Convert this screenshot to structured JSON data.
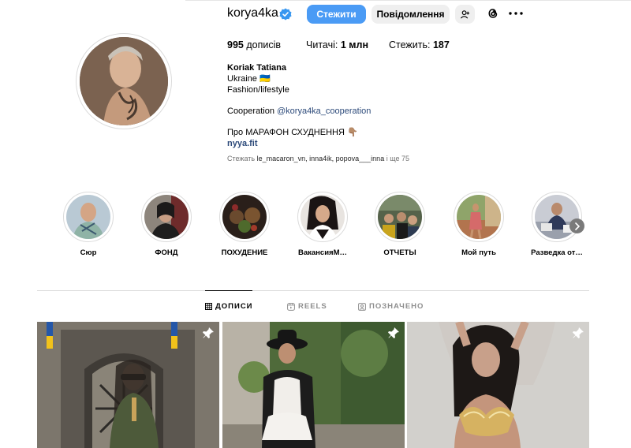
{
  "profile": {
    "username": "korya4ka",
    "verified": true,
    "follow_label": "Стежити",
    "message_label": "Повідомлення",
    "add_user_icon": "add-user-icon",
    "threads_icon": "threads-icon",
    "more_icon": "more-icon"
  },
  "stats": {
    "posts_count": "995",
    "posts_label": "дописів",
    "followers_label": "Читачі:",
    "followers_count": "1 млн",
    "following_label": "Стежить:",
    "following_count": "187"
  },
  "bio": {
    "full_name": "Koriak Tatiana",
    "line_country": "Ukraine 🇺🇦",
    "line_category": "Fashion/lifestyle",
    "cooperation_prefix": "Cooperation ",
    "cooperation_handle": "@korya4ka_cooperation",
    "marathon": "Про МАРАФОН СХУДНЕННЯ 👇🏽",
    "website": "nyya.fit"
  },
  "followed_by": {
    "prefix": "Стежать ",
    "users": "le_macaron_vn, inna4ik, popova___inna",
    "suffix": " і ще 75"
  },
  "highlights": [
    {
      "label": "Сюр"
    },
    {
      "label": "ФОНД"
    },
    {
      "label": "ПОХУДЕНИЕ"
    },
    {
      "label": "ВакансияМ…"
    },
    {
      "label": "ОТЧЕТЫ"
    },
    {
      "label": "Мой путь"
    },
    {
      "label": "Разведка от…"
    }
  ],
  "tabs": {
    "posts": "ДОПИСИ",
    "reels": "REELS",
    "tagged": "ПОЗНАЧЕНО"
  },
  "colors": {
    "follow_button": "#4a9bf5",
    "verified_badge": "#3897f0",
    "link": "#2c4a7a"
  }
}
